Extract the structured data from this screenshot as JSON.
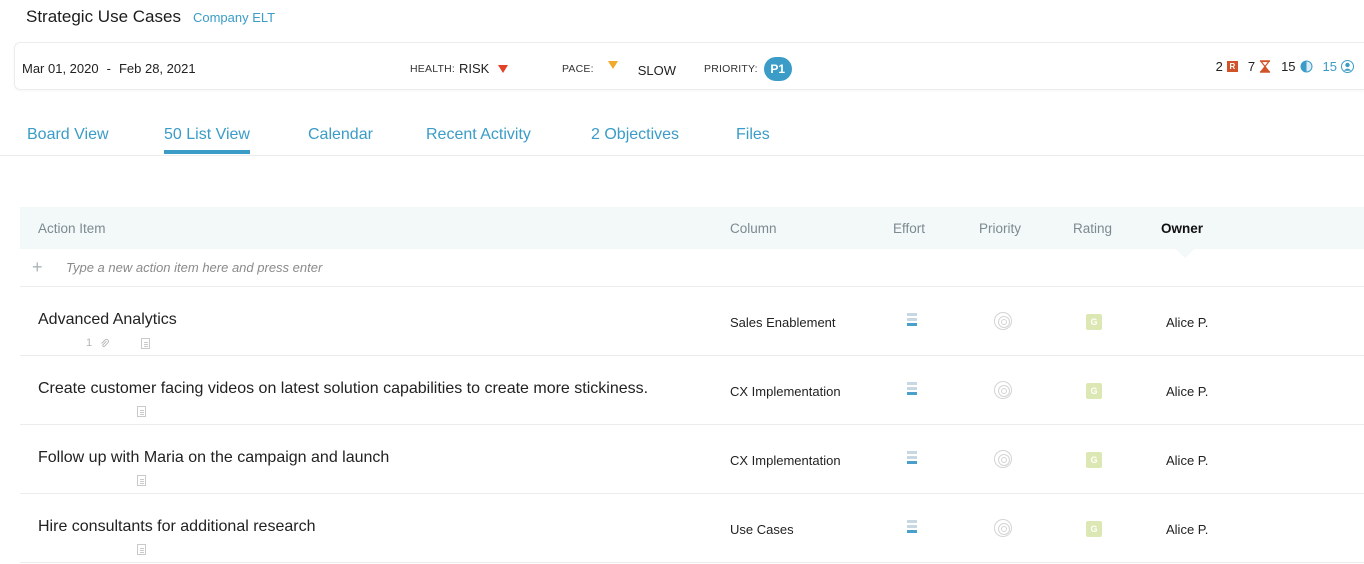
{
  "header": {
    "title": "Strategic Use Cases",
    "subtitle": "Company ELT"
  },
  "status": {
    "start_date": "Mar 01, 2020",
    "separator": "-",
    "end_date": "Feb 28, 2021",
    "health_label": "HEALTH:",
    "health_value": "RISK",
    "pace_label": "PACE:",
    "pace_value": "SLOW",
    "priority_label": "PRIORITY:",
    "priority_value": "P1",
    "counters": {
      "risks": "2",
      "risk_badge": "R",
      "overdue": "7",
      "progress": "15",
      "members": "15"
    },
    "colors": {
      "health": "#e2412a",
      "pace": "#f0a92a",
      "accent": "#3a9cc7"
    }
  },
  "tabs": [
    {
      "label": "Board View"
    },
    {
      "label": "50 List View",
      "active": true
    },
    {
      "label": "Calendar"
    },
    {
      "label": "Recent Activity"
    },
    {
      "label": "2 Objectives"
    },
    {
      "label": "Files"
    }
  ],
  "table": {
    "columns": {
      "action_item": "Action Item",
      "column": "Column",
      "effort": "Effort",
      "priority": "Priority",
      "rating": "Rating",
      "owner": "Owner"
    },
    "add_placeholder": "Type a new action item here and press enter",
    "rows": [
      {
        "title": "Advanced Analytics",
        "attachments": "1",
        "column": "Sales Enablement",
        "rating": "G",
        "owner": "Alice P."
      },
      {
        "title": "Create customer facing videos on latest solution capabilities to create more stickiness.",
        "column": "CX Implementation",
        "rating": "G",
        "owner": "Alice P."
      },
      {
        "title": "Follow up with Maria on the campaign and launch",
        "column": "CX Implementation",
        "rating": "G",
        "owner": "Alice P."
      },
      {
        "title": "Hire consultants for additional research",
        "column": "Use Cases",
        "rating": "G",
        "owner": "Alice P."
      }
    ]
  }
}
